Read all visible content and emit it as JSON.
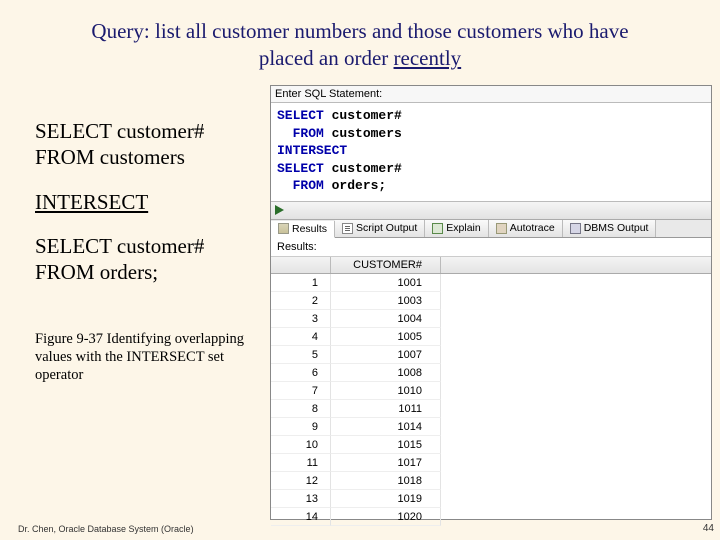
{
  "title_line1": "Query: list all customer numbers and those customers who have",
  "title_line2_a": "placed an order ",
  "title_line2_b": "recently",
  "sql_left": {
    "line1": "SELECT customer#",
    "line2": " FROM customers",
    "intersect": "INTERSECT",
    "line3": "SELECT customer#",
    "line4": " FROM orders;"
  },
  "caption": "Figure 9-37  Identifying overlapping values with the INTERSECT set operator",
  "footer_left": "Dr. Chen, Oracle Database System (Oracle)",
  "footer_right": "44",
  "panel": {
    "enter_label": "Enter SQL Statement:",
    "sql_lines": [
      {
        "kw": "SELECT",
        "rest": " customer#"
      },
      {
        "kw": "  FROM",
        "rest": " customers"
      },
      {
        "kw": "INTERSECT",
        "rest": ""
      },
      {
        "kw": "SELECT",
        "rest": " customer#"
      },
      {
        "kw": "  FROM",
        "rest": " orders;"
      }
    ],
    "tabs": [
      "Results",
      "Script Output",
      "Explain",
      "Autotrace",
      "DBMS Output"
    ],
    "results_label": "Results:",
    "column_header": "CUSTOMER#",
    "rows": [
      {
        "n": "1",
        "v": "1001"
      },
      {
        "n": "2",
        "v": "1003"
      },
      {
        "n": "3",
        "v": "1004"
      },
      {
        "n": "4",
        "v": "1005"
      },
      {
        "n": "5",
        "v": "1007"
      },
      {
        "n": "6",
        "v": "1008"
      },
      {
        "n": "7",
        "v": "1010"
      },
      {
        "n": "8",
        "v": "1011"
      },
      {
        "n": "9",
        "v": "1014"
      },
      {
        "n": "10",
        "v": "1015"
      },
      {
        "n": "11",
        "v": "1017"
      },
      {
        "n": "12",
        "v": "1018"
      },
      {
        "n": "13",
        "v": "1019"
      },
      {
        "n": "14",
        "v": "1020"
      }
    ]
  }
}
